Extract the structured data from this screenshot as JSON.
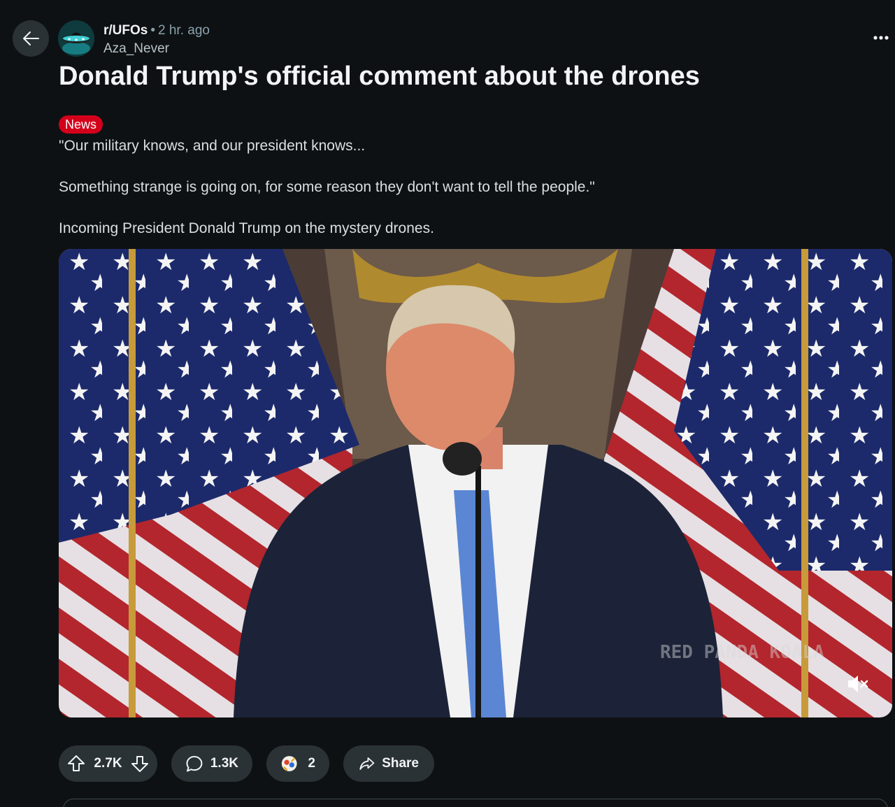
{
  "post": {
    "subreddit": "r/UFOs",
    "separator": "•",
    "time_ago": "2 hr. ago",
    "author": "Aza_Never",
    "title": "Donald Trump's official comment about the drones",
    "flair": "News",
    "body": [
      "\"Our military knows, and our president knows...",
      "Something strange is going on, for some reason they don't want to tell the people.\"",
      "Incoming President Donald Trump on the mystery drones."
    ],
    "video_watermark": "RED PANDA KOALA"
  },
  "actions": {
    "upvotes": "2.7K",
    "comments": "1.3K",
    "awards": "2",
    "share_label": "Share"
  },
  "icons": {
    "back": "arrow-left-icon",
    "more": "ellipsis-icon",
    "upvote": "arrow-up-icon",
    "downvote": "arrow-down-icon",
    "comment": "speech-bubble-icon",
    "award": "award-icon",
    "share": "share-arrow-icon",
    "mute": "speaker-muted-icon"
  },
  "colors": {
    "background": "#0e1113",
    "pill": "#2a3236",
    "flair": "#d4001b",
    "muted_text": "#8ba2ad"
  }
}
